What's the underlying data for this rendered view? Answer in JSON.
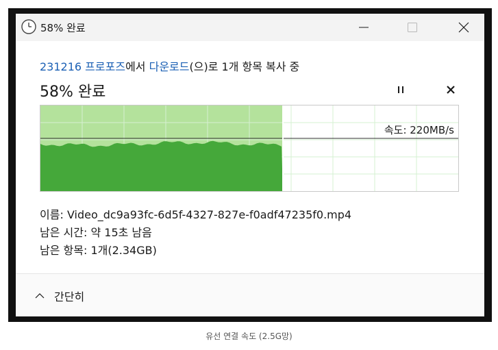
{
  "window": {
    "title": "58% 완료",
    "icon": "clock-icon",
    "controls": {
      "minimize": "minimize-icon",
      "maximize": "maximize-icon",
      "close": "close-icon"
    }
  },
  "copy": {
    "count": "231216",
    "source_folder": "프로포즈",
    "from_word": "에서",
    "dest_folder": "다운로드",
    "action_text": "(으)로 1개 항목 복사 중",
    "percent_label": "58% 완료",
    "progress_percent": 58,
    "speed_text": "속도: 220MB/s",
    "pause_icon": "pause-icon",
    "cancel_icon": "cancel-icon"
  },
  "details": {
    "name_label": "이름:",
    "name_value": "Video_dc9a93fc-6d5f-4327-827e-f0adf47235f0.mp4",
    "time_label": "남은 시간:",
    "time_value": "약 15초 남음",
    "items_label": "남은 항목:",
    "items_value": "1개(2.34GB)"
  },
  "footer": {
    "less_label": "간단히",
    "less_icon": "chevron-up-icon"
  },
  "caption": "유선 연결 속도 (2.5G망)",
  "colors": {
    "graph_fill": "#45a83a",
    "graph_progress_bg": "#b4e29c",
    "graph_grid": "#d6f0d2",
    "link": "#1a5fb4"
  }
}
